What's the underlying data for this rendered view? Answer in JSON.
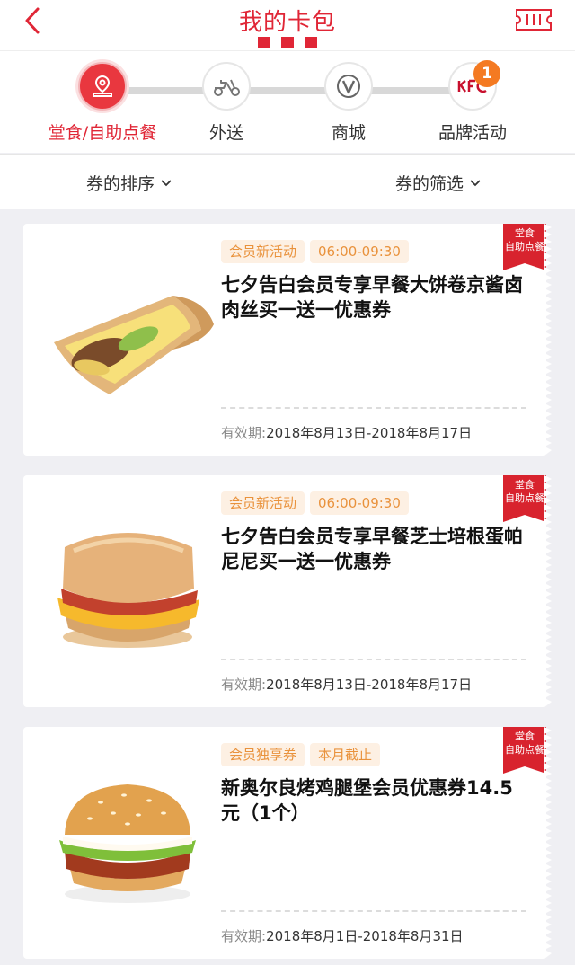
{
  "header": {
    "title": "我的卡包"
  },
  "steps": [
    {
      "label": "堂食/自助点餐",
      "icon": "store-pin-icon",
      "active": true
    },
    {
      "label": "外送",
      "icon": "scooter-icon",
      "active": false
    },
    {
      "label": "商城",
      "icon": "v-mall-icon",
      "active": false
    },
    {
      "label": "品牌活动",
      "icon": "kfc-logo-icon",
      "active": false,
      "badge": "1"
    }
  ],
  "sortbar": {
    "sort_label": "券的排序",
    "filter_label": "券的筛选"
  },
  "coupons": [
    {
      "tags": [
        "会员新活动",
        "06:00-09:30"
      ],
      "title": "七夕告白会员专享早餐大饼卷京酱卤肉丝买一送一优惠券",
      "validity_label": "有效期:",
      "validity_value": "2018年8月13日-2018年8月17日",
      "corner": [
        "堂食",
        "自助点餐"
      ],
      "food": "wrap-image"
    },
    {
      "tags": [
        "会员新活动",
        "06:00-09:30"
      ],
      "title": "七夕告白会员专享早餐芝士培根蛋帕尼尼买一送一优惠券",
      "validity_label": "有效期:",
      "validity_value": "2018年8月13日-2018年8月17日",
      "corner": [
        "堂食",
        "自助点餐"
      ],
      "food": "panini-image"
    },
    {
      "tags": [
        "会员独享券",
        "本月截止"
      ],
      "title": "新奥尔良烤鸡腿堡会员优惠券14.5元（1个）",
      "validity_label": "有效期:",
      "validity_value": "2018年8月1日-2018年8月31日",
      "corner": [
        "堂食",
        "自助点餐"
      ],
      "food": "burger-image"
    }
  ],
  "colors": {
    "brand_red": "#e02636",
    "tag_bg": "#fdf0e3",
    "tag_text": "#e9923c",
    "badge": "#f47a22"
  }
}
